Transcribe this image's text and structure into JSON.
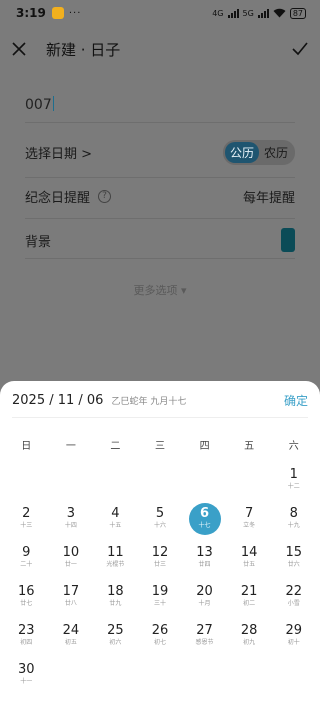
{
  "status": {
    "time": "3:19",
    "dots": "···",
    "network": "4G",
    "network2": "5G",
    "battery": "87"
  },
  "header": {
    "title": "新建 · 日子"
  },
  "form": {
    "name_value": "007",
    "date_label": "选择日期 >",
    "calendar_solar": "公历",
    "calendar_lunar": "农历",
    "reminder_label": "纪念日提醒",
    "reminder_value": "每年提醒",
    "background_label": "背景",
    "more_options": "更多选项"
  },
  "colors": {
    "accent": "#3aa0c8",
    "background_chip": "#0b4b57"
  },
  "picker": {
    "date": "2025 / 11 / 06",
    "lunar": "乙巳蛇年 九月十七",
    "confirm": "确定",
    "weekdays": [
      "日",
      "一",
      "二",
      "三",
      "四",
      "五",
      "六"
    ],
    "days": [
      {
        "d": "",
        "l": ""
      },
      {
        "d": "",
        "l": ""
      },
      {
        "d": "",
        "l": ""
      },
      {
        "d": "",
        "l": ""
      },
      {
        "d": "",
        "l": ""
      },
      {
        "d": "",
        "l": ""
      },
      {
        "d": "1",
        "l": "十二"
      },
      {
        "d": "2",
        "l": "十三"
      },
      {
        "d": "3",
        "l": "十四"
      },
      {
        "d": "4",
        "l": "十五"
      },
      {
        "d": "5",
        "l": "十六"
      },
      {
        "d": "6",
        "l": "十七",
        "sel": true
      },
      {
        "d": "7",
        "l": "立冬"
      },
      {
        "d": "8",
        "l": "十九"
      },
      {
        "d": "9",
        "l": "二十"
      },
      {
        "d": "10",
        "l": "廿一"
      },
      {
        "d": "11",
        "l": "光棍节"
      },
      {
        "d": "12",
        "l": "廿三"
      },
      {
        "d": "13",
        "l": "廿四"
      },
      {
        "d": "14",
        "l": "廿五"
      },
      {
        "d": "15",
        "l": "廿六"
      },
      {
        "d": "16",
        "l": "廿七"
      },
      {
        "d": "17",
        "l": "廿八"
      },
      {
        "d": "18",
        "l": "廿九"
      },
      {
        "d": "19",
        "l": "三十"
      },
      {
        "d": "20",
        "l": "十月"
      },
      {
        "d": "21",
        "l": "初二"
      },
      {
        "d": "22",
        "l": "小雪"
      },
      {
        "d": "23",
        "l": "初四"
      },
      {
        "d": "24",
        "l": "初五"
      },
      {
        "d": "25",
        "l": "初六"
      },
      {
        "d": "26",
        "l": "初七"
      },
      {
        "d": "27",
        "l": "感恩节"
      },
      {
        "d": "28",
        "l": "初九"
      },
      {
        "d": "29",
        "l": "初十"
      },
      {
        "d": "30",
        "l": "十一"
      }
    ]
  }
}
